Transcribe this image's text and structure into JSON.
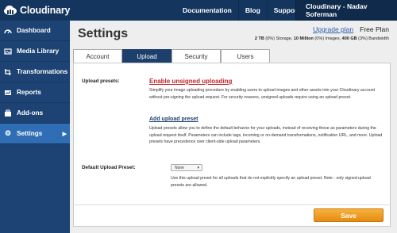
{
  "app": {
    "name": "Cloudinary"
  },
  "top_nav": {
    "documentation": "Documentation",
    "blog": "Blog",
    "support": "Support",
    "user": "Cloudinary - Nadav Soferman"
  },
  "sidebar": {
    "items": [
      {
        "label": "Dashboard",
        "icon": "dashboard-icon"
      },
      {
        "label": "Media Library",
        "icon": "media-library-icon"
      },
      {
        "label": "Transformations",
        "icon": "transformations-icon"
      },
      {
        "label": "Reports",
        "icon": "reports-icon"
      },
      {
        "label": "Add-ons",
        "icon": "addons-icon"
      },
      {
        "label": "Settings",
        "icon": "gear-icon",
        "active": true
      }
    ]
  },
  "header": {
    "title": "Settings",
    "upgrade": "Upgrade plan",
    "plan": "Free Plan",
    "usage_storage_value": "2 TB",
    "usage_storage_rest": " (0%) Storage, ",
    "usage_images_value": "10 Million",
    "usage_images_rest": " (0%) Images, ",
    "usage_bw_value": "400 GB",
    "usage_bw_rest": " (3%) Bandwidth"
  },
  "tabs": [
    {
      "label": "Account"
    },
    {
      "label": "Upload",
      "active": true
    },
    {
      "label": "Security"
    },
    {
      "label": "Users"
    }
  ],
  "upload": {
    "presets_label": "Upload presets:",
    "enable_unsigned": "Enable unsigned uploading",
    "unsigned_desc": "Simplify your image uploading procedure by enabling users to upload images and other assets into your Cloudinary account without pre-signing the upload request. For security reasons, unsigned uploads require using an upload preset.",
    "add_preset": "Add upload preset",
    "preset_desc": "Upload presets allow you to define the default behavior for your uploads, instead of receiving these as parameters during the upload request itself. Parameters can include tags, incoming or on-demand transformations, notification URL, and more. Upload presets have precedence over client-side upload parameters.",
    "default_label": "Default Upload Preset:",
    "default_value": "None",
    "default_desc": "Use this upload preset for all uploads that do not explicitly specify an upload preset. Note - only signed upload presets are allowed."
  },
  "actions": {
    "save": "Save"
  },
  "colors": {
    "topbar": "#14355e",
    "sidebar": "#1d4274",
    "active": "#2f6eb5",
    "save": "#f0a12a",
    "link_red": "#c0272d"
  }
}
